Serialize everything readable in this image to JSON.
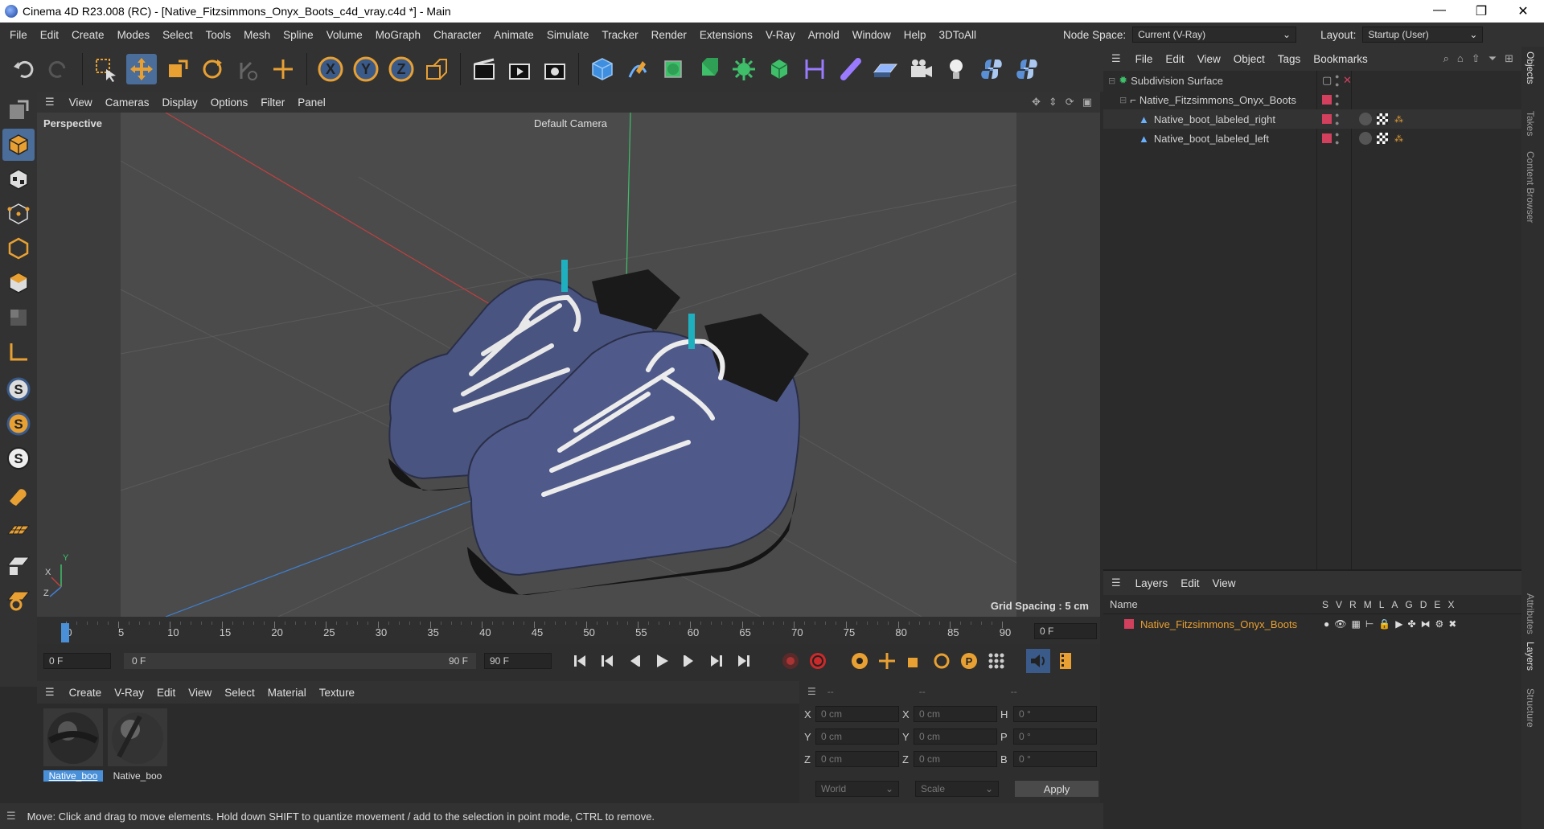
{
  "window": {
    "title": "Cinema 4D R23.008 (RC) - [Native_Fitzsimmons_Onyx_Boots_c4d_vray.c4d *] - Main",
    "minimize": "—",
    "restore": "❐",
    "close": "✕"
  },
  "menu": [
    "File",
    "Edit",
    "Create",
    "Modes",
    "Select",
    "Tools",
    "Mesh",
    "Spline",
    "Volume",
    "MoGraph",
    "Character",
    "Animate",
    "Simulate",
    "Tracker",
    "Render",
    "Extensions",
    "V-Ray",
    "Arnold",
    "Window",
    "Help",
    "3DToAll"
  ],
  "node_space": {
    "label": "Node Space:",
    "value": "Current (V-Ray)"
  },
  "layout": {
    "label": "Layout:",
    "value": "Startup (User)"
  },
  "viewport": {
    "menu": [
      "View",
      "Cameras",
      "Display",
      "Options",
      "Filter",
      "Panel"
    ],
    "label": "Perspective",
    "camera": "Default Camera",
    "grid_spacing": "Grid Spacing : 5 cm",
    "axis": {
      "x": "X",
      "y": "Y",
      "z": "Z"
    }
  },
  "timeline": {
    "ticks": [
      "0",
      "5",
      "10",
      "15",
      "20",
      "25",
      "30",
      "35",
      "40",
      "45",
      "50",
      "55",
      "60",
      "65",
      "70",
      "75",
      "80",
      "85",
      "90"
    ],
    "current_frame_field": "0 F"
  },
  "playback": {
    "start": "0 F",
    "range_start": "0 F",
    "range_end": "90 F",
    "end": "90 F"
  },
  "material_menu": [
    "Create",
    "V-Ray",
    "Edit",
    "View",
    "Select",
    "Material",
    "Texture"
  ],
  "materials": [
    {
      "label": "Native_boo"
    },
    {
      "label": "Native_boo"
    }
  ],
  "coords": {
    "header": [
      "--",
      "--",
      "--"
    ],
    "rows": [
      {
        "a": "X",
        "av": "0 cm",
        "b": "X",
        "bv": "0 cm",
        "c": "H",
        "cv": "0 °"
      },
      {
        "a": "Y",
        "av": "0 cm",
        "b": "Y",
        "bv": "0 cm",
        "c": "P",
        "cv": "0 °"
      },
      {
        "a": "Z",
        "av": "0 cm",
        "b": "Z",
        "bv": "0 cm",
        "c": "B",
        "cv": "0 °"
      }
    ],
    "mode1": "World",
    "mode2": "Scale",
    "apply": "Apply"
  },
  "status": "Move: Click and drag to move elements. Hold down SHIFT to quantize movement / add to the selection in point mode, CTRL to remove.",
  "object_manager": {
    "menu": [
      "File",
      "Edit",
      "View",
      "Object",
      "Tags",
      "Bookmarks"
    ],
    "objects": [
      {
        "name": "Subdivision Surface"
      },
      {
        "name": "Native_Fitzsimmons_Onyx_Boots"
      },
      {
        "name": "Native_boot_labeled_right"
      },
      {
        "name": "Native_boot_labeled_left"
      }
    ]
  },
  "layer_manager": {
    "menu": [
      "Layers",
      "Edit",
      "View"
    ],
    "columns": {
      "name": "Name",
      "flags": [
        "S",
        "V",
        "R",
        "M",
        "L",
        "A",
        "G",
        "D",
        "E",
        "X"
      ]
    },
    "layers": [
      {
        "name": "Native_Fitzsimmons_Onyx_Boots",
        "color": "#d2405e"
      }
    ]
  },
  "side_tabs": [
    "Objects",
    "Takes",
    "Content Browser",
    "Attributes",
    "Layers",
    "Structure"
  ],
  "colors": {
    "accent": "#4a90d9",
    "layer_text": "#e8a033",
    "tag_red": "#d2405e"
  }
}
